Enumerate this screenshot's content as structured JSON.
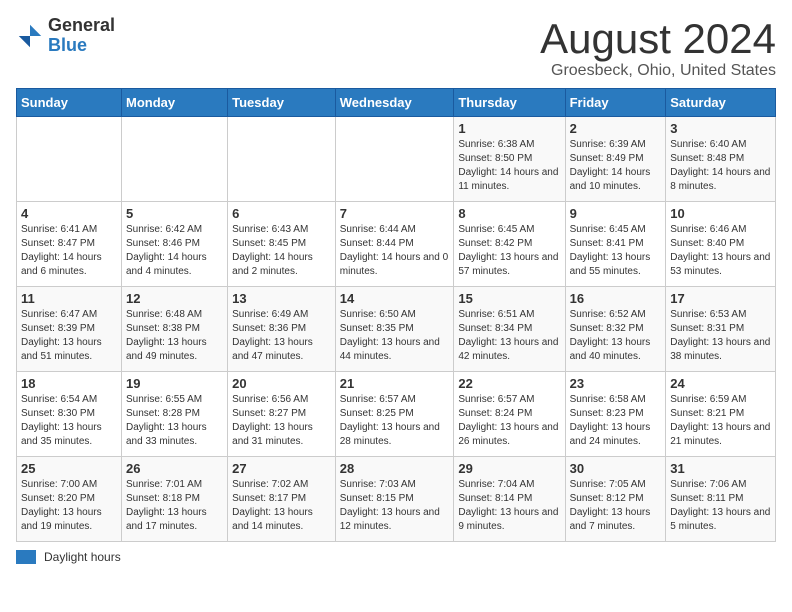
{
  "logo": {
    "general": "General",
    "blue": "Blue"
  },
  "title": "August 2024",
  "subtitle": "Groesbeck, Ohio, United States",
  "days_of_week": [
    "Sunday",
    "Monday",
    "Tuesday",
    "Wednesday",
    "Thursday",
    "Friday",
    "Saturday"
  ],
  "legend_label": "Daylight hours",
  "weeks": [
    [
      {
        "day": "",
        "sunrise": "",
        "sunset": "",
        "daylight": ""
      },
      {
        "day": "",
        "sunrise": "",
        "sunset": "",
        "daylight": ""
      },
      {
        "day": "",
        "sunrise": "",
        "sunset": "",
        "daylight": ""
      },
      {
        "day": "",
        "sunrise": "",
        "sunset": "",
        "daylight": ""
      },
      {
        "day": "1",
        "sunrise": "Sunrise: 6:38 AM",
        "sunset": "Sunset: 8:50 PM",
        "daylight": "Daylight: 14 hours and 11 minutes."
      },
      {
        "day": "2",
        "sunrise": "Sunrise: 6:39 AM",
        "sunset": "Sunset: 8:49 PM",
        "daylight": "Daylight: 14 hours and 10 minutes."
      },
      {
        "day": "3",
        "sunrise": "Sunrise: 6:40 AM",
        "sunset": "Sunset: 8:48 PM",
        "daylight": "Daylight: 14 hours and 8 minutes."
      }
    ],
    [
      {
        "day": "4",
        "sunrise": "Sunrise: 6:41 AM",
        "sunset": "Sunset: 8:47 PM",
        "daylight": "Daylight: 14 hours and 6 minutes."
      },
      {
        "day": "5",
        "sunrise": "Sunrise: 6:42 AM",
        "sunset": "Sunset: 8:46 PM",
        "daylight": "Daylight: 14 hours and 4 minutes."
      },
      {
        "day": "6",
        "sunrise": "Sunrise: 6:43 AM",
        "sunset": "Sunset: 8:45 PM",
        "daylight": "Daylight: 14 hours and 2 minutes."
      },
      {
        "day": "7",
        "sunrise": "Sunrise: 6:44 AM",
        "sunset": "Sunset: 8:44 PM",
        "daylight": "Daylight: 14 hours and 0 minutes."
      },
      {
        "day": "8",
        "sunrise": "Sunrise: 6:45 AM",
        "sunset": "Sunset: 8:42 PM",
        "daylight": "Daylight: 13 hours and 57 minutes."
      },
      {
        "day": "9",
        "sunrise": "Sunrise: 6:45 AM",
        "sunset": "Sunset: 8:41 PM",
        "daylight": "Daylight: 13 hours and 55 minutes."
      },
      {
        "day": "10",
        "sunrise": "Sunrise: 6:46 AM",
        "sunset": "Sunset: 8:40 PM",
        "daylight": "Daylight: 13 hours and 53 minutes."
      }
    ],
    [
      {
        "day": "11",
        "sunrise": "Sunrise: 6:47 AM",
        "sunset": "Sunset: 8:39 PM",
        "daylight": "Daylight: 13 hours and 51 minutes."
      },
      {
        "day": "12",
        "sunrise": "Sunrise: 6:48 AM",
        "sunset": "Sunset: 8:38 PM",
        "daylight": "Daylight: 13 hours and 49 minutes."
      },
      {
        "day": "13",
        "sunrise": "Sunrise: 6:49 AM",
        "sunset": "Sunset: 8:36 PM",
        "daylight": "Daylight: 13 hours and 47 minutes."
      },
      {
        "day": "14",
        "sunrise": "Sunrise: 6:50 AM",
        "sunset": "Sunset: 8:35 PM",
        "daylight": "Daylight: 13 hours and 44 minutes."
      },
      {
        "day": "15",
        "sunrise": "Sunrise: 6:51 AM",
        "sunset": "Sunset: 8:34 PM",
        "daylight": "Daylight: 13 hours and 42 minutes."
      },
      {
        "day": "16",
        "sunrise": "Sunrise: 6:52 AM",
        "sunset": "Sunset: 8:32 PM",
        "daylight": "Daylight: 13 hours and 40 minutes."
      },
      {
        "day": "17",
        "sunrise": "Sunrise: 6:53 AM",
        "sunset": "Sunset: 8:31 PM",
        "daylight": "Daylight: 13 hours and 38 minutes."
      }
    ],
    [
      {
        "day": "18",
        "sunrise": "Sunrise: 6:54 AM",
        "sunset": "Sunset: 8:30 PM",
        "daylight": "Daylight: 13 hours and 35 minutes."
      },
      {
        "day": "19",
        "sunrise": "Sunrise: 6:55 AM",
        "sunset": "Sunset: 8:28 PM",
        "daylight": "Daylight: 13 hours and 33 minutes."
      },
      {
        "day": "20",
        "sunrise": "Sunrise: 6:56 AM",
        "sunset": "Sunset: 8:27 PM",
        "daylight": "Daylight: 13 hours and 31 minutes."
      },
      {
        "day": "21",
        "sunrise": "Sunrise: 6:57 AM",
        "sunset": "Sunset: 8:25 PM",
        "daylight": "Daylight: 13 hours and 28 minutes."
      },
      {
        "day": "22",
        "sunrise": "Sunrise: 6:57 AM",
        "sunset": "Sunset: 8:24 PM",
        "daylight": "Daylight: 13 hours and 26 minutes."
      },
      {
        "day": "23",
        "sunrise": "Sunrise: 6:58 AM",
        "sunset": "Sunset: 8:23 PM",
        "daylight": "Daylight: 13 hours and 24 minutes."
      },
      {
        "day": "24",
        "sunrise": "Sunrise: 6:59 AM",
        "sunset": "Sunset: 8:21 PM",
        "daylight": "Daylight: 13 hours and 21 minutes."
      }
    ],
    [
      {
        "day": "25",
        "sunrise": "Sunrise: 7:00 AM",
        "sunset": "Sunset: 8:20 PM",
        "daylight": "Daylight: 13 hours and 19 minutes."
      },
      {
        "day": "26",
        "sunrise": "Sunrise: 7:01 AM",
        "sunset": "Sunset: 8:18 PM",
        "daylight": "Daylight: 13 hours and 17 minutes."
      },
      {
        "day": "27",
        "sunrise": "Sunrise: 7:02 AM",
        "sunset": "Sunset: 8:17 PM",
        "daylight": "Daylight: 13 hours and 14 minutes."
      },
      {
        "day": "28",
        "sunrise": "Sunrise: 7:03 AM",
        "sunset": "Sunset: 8:15 PM",
        "daylight": "Daylight: 13 hours and 12 minutes."
      },
      {
        "day": "29",
        "sunrise": "Sunrise: 7:04 AM",
        "sunset": "Sunset: 8:14 PM",
        "daylight": "Daylight: 13 hours and 9 minutes."
      },
      {
        "day": "30",
        "sunrise": "Sunrise: 7:05 AM",
        "sunset": "Sunset: 8:12 PM",
        "daylight": "Daylight: 13 hours and 7 minutes."
      },
      {
        "day": "31",
        "sunrise": "Sunrise: 7:06 AM",
        "sunset": "Sunset: 8:11 PM",
        "daylight": "Daylight: 13 hours and 5 minutes."
      }
    ]
  ]
}
